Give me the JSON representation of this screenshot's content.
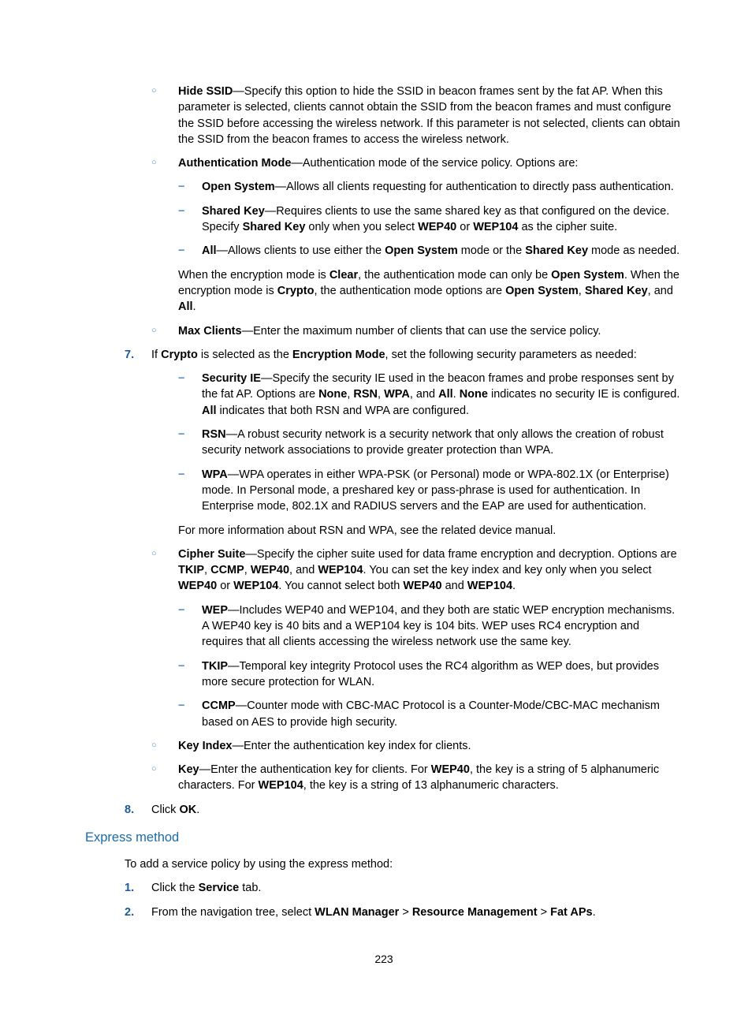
{
  "items": {
    "hideSsid": {
      "label": "Hide SSID",
      "rest": "—Specify this option to hide the SSID in beacon frames sent by the fat AP. When this parameter is selected, clients cannot obtain the SSID from the beacon frames and must configure the SSID before accessing the wireless network. If this parameter is not selected, clients can obtain the SSID from the beacon frames to access the wireless network."
    },
    "authMode": {
      "label": "Authentication Mode",
      "rest": "—Authentication mode of the service policy. Options are:",
      "open": {
        "label": "Open System",
        "rest": "—Allows all clients requesting for authentication to directly pass authentication."
      },
      "shared": {
        "label": "Shared Key",
        "rest1": "—Requires clients to use the same shared key as that configured on the device. Specify ",
        "b1": "Shared Key",
        "rest2": " only when you select ",
        "b2": "WEP40",
        "rest3": " or ",
        "b3": "WEP104",
        "rest4": " as the cipher suite."
      },
      "all": {
        "label": "All",
        "rest1": "—Allows clients to use either the ",
        "b1": "Open System",
        "rest2": " mode or the ",
        "b2": "Shared Key",
        "rest3": " mode as needed."
      },
      "note": {
        "p1a": "When the encryption mode is ",
        "p1b": "Clear",
        "p1c": ", the authentication mode can only be ",
        "p1d": "Open System",
        "p1e": ". When the encryption mode is ",
        "p1f": "Crypto",
        "p1g": ", the authentication mode options are ",
        "p1h": "Open System",
        "p1i": ", ",
        "p1j": "Shared Key",
        "p1k": ", and ",
        "p1l": "All",
        "p1m": "."
      }
    },
    "maxClients": {
      "label": "Max Clients",
      "rest": "—Enter the maximum number of clients that can use the service policy."
    }
  },
  "step7": {
    "num": "7.",
    "a": "If ",
    "b": "Crypto",
    "c": " is selected as the ",
    "d": "Encryption Mode",
    "e": ", set the following security parameters as needed:",
    "secIE": {
      "label": "Security IE",
      "r1": "—Specify the security IE used in the beacon frames and probe responses sent by the fat AP. Options are ",
      "b1": "None",
      "r2": ", ",
      "b2": "RSN",
      "r3": ", ",
      "b3": "WPA",
      "r4": ", and ",
      "b4": "All",
      "r5": ". ",
      "b5": "None",
      "r6": " indicates no security IE is configured. ",
      "b6": "All",
      "r7": " indicates that both RSN and WPA are configured."
    },
    "rsn": {
      "label": "RSN",
      "rest": "—A robust security network is a security network that only allows the creation of robust security network associations to provide greater protection than WPA."
    },
    "wpa": {
      "label": "WPA",
      "rest": "—WPA operates in either WPA-PSK (or Personal) mode or WPA-802.1X (or Enterprise) mode. In Personal mode, a preshared key or pass-phrase is used for authentication. In Enterprise mode, 802.1X and RADIUS servers and the EAP are used for authentication."
    },
    "note": "For more information about RSN and WPA, see the related device manual.",
    "cipher": {
      "label": "Cipher Suite",
      "r1": "—Specify the cipher suite used for data frame encryption and decryption. Options are ",
      "b1": "TKIP",
      "r2": ", ",
      "b2": "CCMP",
      "r3": ", ",
      "b3": "WEP40",
      "r4": ", and ",
      "b4": "WEP104",
      "r5": ". You can set the key index and key only when you select ",
      "b5": "WEP40",
      "r6": " or ",
      "b6": "WEP104",
      "r7": ". You cannot select both ",
      "b7": "WEP40",
      "r8": " and ",
      "b8": "WEP104",
      "r9": "."
    },
    "wep": {
      "label": "WEP",
      "rest": "—Includes WEP40 and WEP104, and they both are static WEP encryption mechanisms. A WEP40 key is 40 bits and a WEP104 key is 104 bits. WEP uses RC4 encryption and requires that all clients accessing the wireless network use the same key."
    },
    "tkip": {
      "label": "TKIP",
      "rest": "—Temporal key integrity Protocol uses the RC4 algorithm as WEP does, but provides more secure protection for WLAN."
    },
    "ccmp": {
      "label": "CCMP",
      "rest": "—Counter mode with CBC-MAC Protocol is a Counter-Mode/CBC-MAC mechanism based on AES to provide high security."
    },
    "keyIndex": {
      "label": "Key Index",
      "rest": "—Enter the authentication key index for clients."
    },
    "key": {
      "label": "Key",
      "r1": "—Enter the authentication key for clients. For ",
      "b1": "WEP40",
      "r2": ", the key is a string of 5 alphanumeric characters. For ",
      "b2": "WEP104",
      "r3": ", the key is a string of 13 alphanumeric characters."
    }
  },
  "step8": {
    "num": "8.",
    "a": "Click ",
    "b": "OK",
    "c": "."
  },
  "express": {
    "heading": "Express method",
    "intro": "To add a service policy by using the express method:",
    "s1": {
      "num": "1.",
      "a": "Click the ",
      "b": "Service",
      "c": " tab."
    },
    "s2": {
      "num": "2.",
      "a": "From the navigation tree, select ",
      "b1": "WLAN Manager",
      "gt1": " > ",
      "b2": "Resource Management",
      "gt2": " > ",
      "b3": "Fat APs",
      "end": "."
    }
  },
  "pagenum": "223"
}
